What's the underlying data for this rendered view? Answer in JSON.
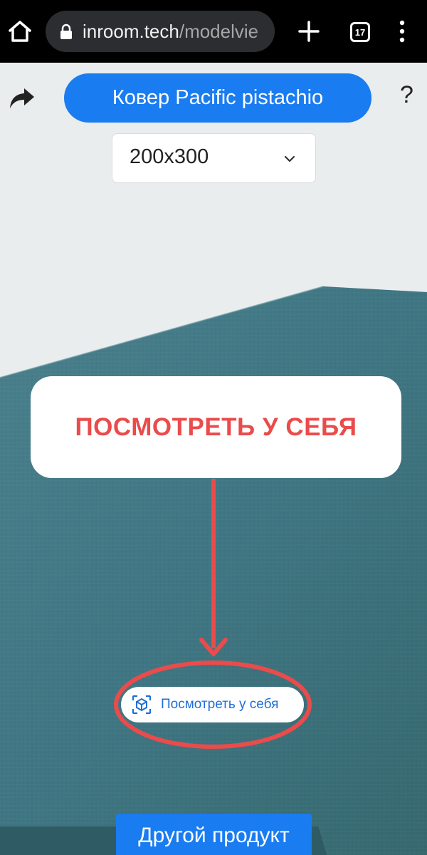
{
  "browser": {
    "url_host": "inroom.tech",
    "url_path": "/modelvie",
    "tab_count": "17",
    "icons": [
      "home-icon",
      "lock-icon",
      "plus-icon",
      "tab-switcher-icon",
      "overflow-menu-icon"
    ]
  },
  "header": {
    "title": "Ковер Pacific pistachio",
    "help_label": "?",
    "icons": [
      "share-arrow-icon"
    ]
  },
  "size_select": {
    "value": "200x300",
    "icon": "chevron-down-icon"
  },
  "callout": {
    "text": "ПОСМОТРЕТЬ У СЕБЯ",
    "color": "#ea4b4b"
  },
  "ar_button": {
    "label": "Посмотреть у себя",
    "icon": "ar-cube-icon"
  },
  "footer": {
    "other_product_label": "Другой продукт"
  },
  "colors": {
    "accent": "#1a7cf1",
    "rug": "#3f7683",
    "background": "#e9edee",
    "annotation": "#ea4b4b"
  }
}
